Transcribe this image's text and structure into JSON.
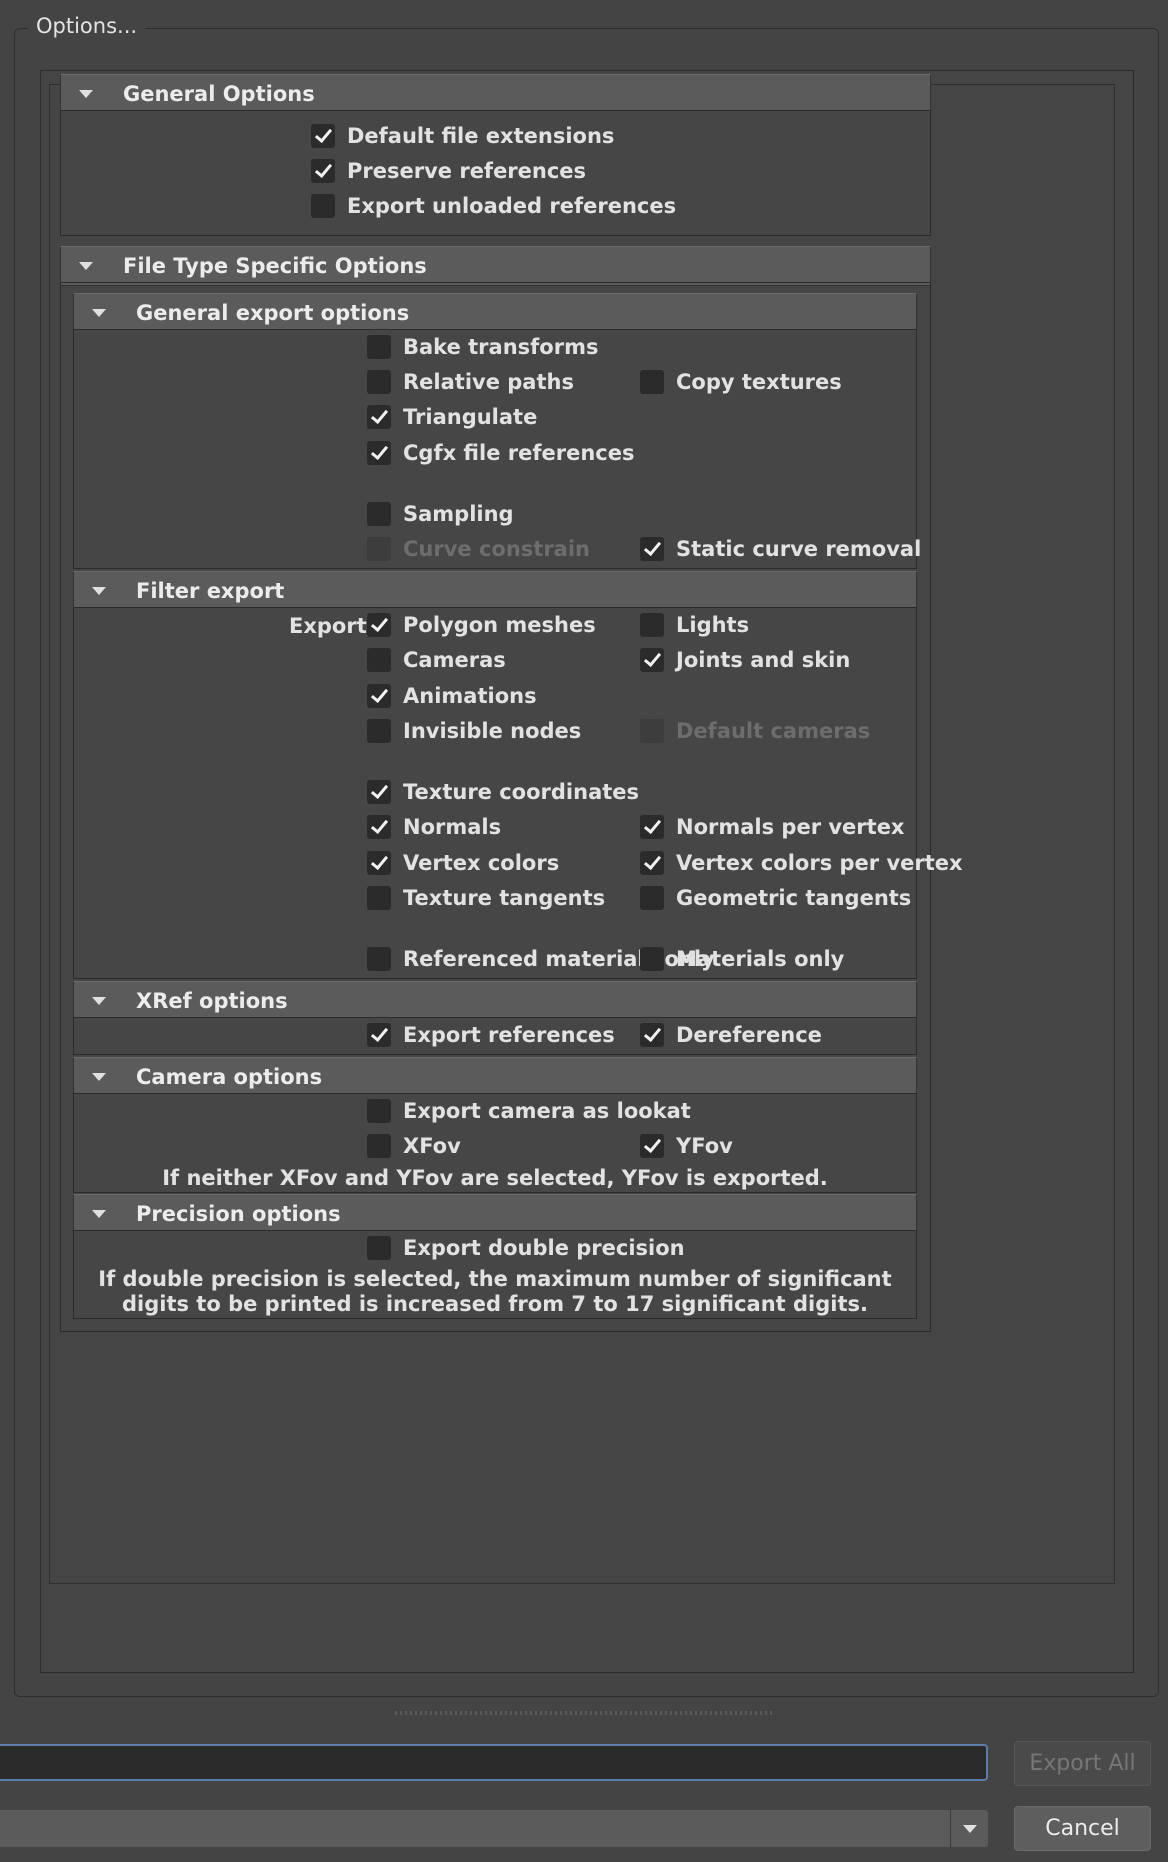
{
  "options_group": {
    "title": "Options..."
  },
  "general_options": {
    "header": "General Options",
    "items": [
      {
        "label": "Default file extensions",
        "checked": true
      },
      {
        "label": "Preserve references",
        "checked": true
      },
      {
        "label": "Export unloaded references",
        "checked": false
      }
    ]
  },
  "file_type_specific": {
    "header": "File Type Specific Options"
  },
  "general_export": {
    "header": "General export options",
    "bake_transforms": "Bake transforms",
    "relative_paths": "Relative paths",
    "copy_textures": "Copy textures",
    "triangulate": "Triangulate",
    "cgfx_refs": "Cgfx file references",
    "sampling": "Sampling",
    "curve_constrain": "Curve constrain",
    "static_curve_removal": "Static curve removal"
  },
  "filter_export": {
    "header": "Filter export",
    "export_label": "Export:",
    "polygon_meshes": "Polygon meshes",
    "lights": "Lights",
    "cameras": "Cameras",
    "joints_skin": "Joints and skin",
    "animations": "Animations",
    "invisible_nodes": "Invisible nodes",
    "default_cameras": "Default cameras",
    "texture_coords": "Texture coordinates",
    "normals": "Normals",
    "normals_per_vertex": "Normals per vertex",
    "vertex_colors": "Vertex colors",
    "vertex_colors_per_vertex": "Vertex colors per vertex",
    "texture_tangents": "Texture tangents",
    "geometric_tangents": "Geometric tangents",
    "referenced_materials_only": "Referenced materials only",
    "materials_only": "Materials only"
  },
  "xref_options": {
    "header": "XRef options",
    "export_references": "Export references",
    "dereference": "Dereference"
  },
  "camera_options": {
    "header": "Camera options",
    "export_camera_lookat": "Export camera as lookat",
    "xfov": "XFov",
    "yfov": "YFov",
    "note": "If neither XFov and YFov are selected, YFov is exported."
  },
  "precision_options": {
    "header": "Precision options",
    "export_double": "Export double precision",
    "note_line1": "If double precision is selected, the maximum number of significant",
    "note_line2": "digits to be printed is increased from 7 to 17 significant digits."
  },
  "footer": {
    "export_all": "Export All",
    "cancel": "Cancel"
  }
}
